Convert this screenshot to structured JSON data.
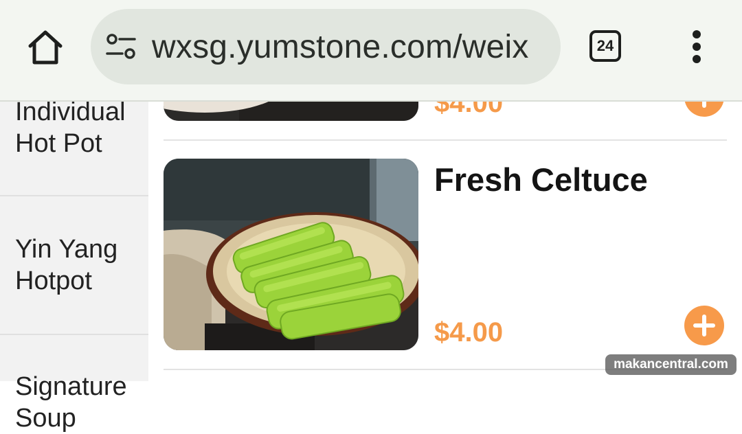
{
  "browser": {
    "url": "wxsg.yumstone.com/weix",
    "tab_count": "24"
  },
  "sidebar": {
    "categories": [
      {
        "label": "Individual Hot Pot"
      },
      {
        "label": "Yin Yang Hotpot"
      },
      {
        "label": "Signature Soup"
      }
    ]
  },
  "products": [
    {
      "name": "",
      "price": "$4.00"
    },
    {
      "name": "Fresh Celtuce",
      "price": "$4.00"
    }
  ],
  "watermark": "makancentral.com",
  "colors": {
    "accent": "#f79a4a",
    "toolbar": "#f3f6f1",
    "urlbar": "#e1e6df",
    "sidebar": "#f2f2f2"
  },
  "icons": {
    "home": "home-icon",
    "site_settings": "tune-icon",
    "tabs": "tab-switcher-icon",
    "menu": "more-vert-icon",
    "add": "plus-circle-icon"
  }
}
